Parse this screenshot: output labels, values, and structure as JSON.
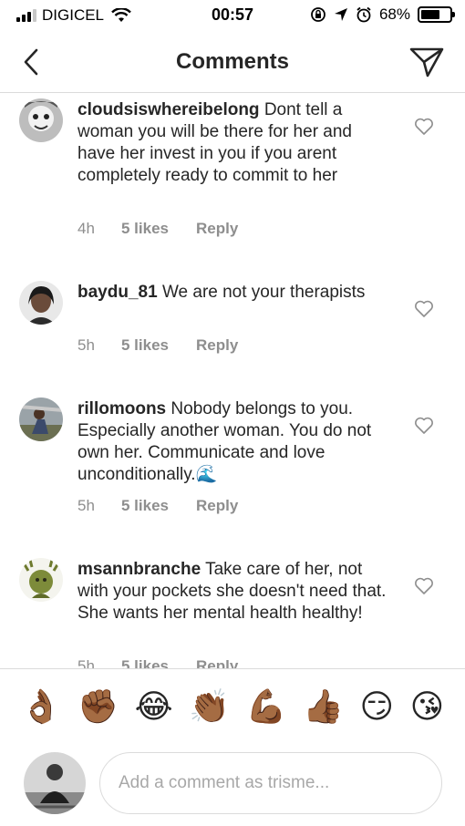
{
  "status_bar": {
    "carrier": "DIGICEL",
    "time": "00:57",
    "battery": "68%",
    "battery_level": 0.68
  },
  "header": {
    "title": "Comments",
    "back_icon": "chevron-left-icon",
    "send_icon": "paper-plane-icon"
  },
  "comments": [
    {
      "username": "cloudsiswhereibelong",
      "text": "Dont tell a woman you will be there for her and have her invest in you if you arent completely ready to commit to her",
      "time": "4h",
      "likes": "5 likes",
      "reply": "Reply"
    },
    {
      "username": "baydu_81",
      "text": "We are not your therapists",
      "time": "5h",
      "likes": "5 likes",
      "reply": "Reply"
    },
    {
      "username": "rillomoons",
      "text": "Nobody belongs to you. Especially another woman. You do not own her. Communicate and love unconditionally.🌊",
      "time": "5h",
      "likes": "5 likes",
      "reply": "Reply"
    },
    {
      "username": "msannbranche",
      "text": "Take care of her, not with your pockets she doesn't need that. She wants her mental health healthy!",
      "time": "5h",
      "likes": "5 likes",
      "reply": "Reply"
    }
  ],
  "emoji_bar": [
    "👌🏾",
    "✊🏾",
    "😂",
    "👏🏾",
    "💪🏾",
    "👍🏾",
    "😏",
    "😘"
  ],
  "composer": {
    "placeholder": "Add a comment as trisme..."
  }
}
